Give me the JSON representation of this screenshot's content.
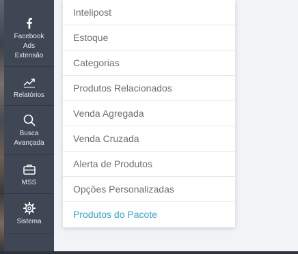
{
  "sidebar": {
    "items": [
      {
        "label": "Facebook\nAds\nExtensão",
        "icon": "facebook-icon"
      },
      {
        "label": "Relatórios",
        "icon": "trend-chart-icon"
      },
      {
        "label": "Busca\nAvançada",
        "icon": "search-icon"
      },
      {
        "label": "MSS",
        "icon": "briefcase-icon"
      },
      {
        "label": "Sistema",
        "icon": "gear-icon"
      }
    ]
  },
  "submenu": {
    "items": [
      "Intelipost",
      "Estoque",
      "Categorias",
      "Produtos Relacionados",
      "Venda Agregada",
      "Venda Cruzada",
      "Alerta de Produtos",
      "Opções Personalizadas",
      "Produtos do Pacote"
    ],
    "active": "Produtos do Pacote"
  },
  "colors": {
    "sidebar_bg": "#3f4654",
    "panel_bg": "#ffffff",
    "page_bg": "#f1f3f7",
    "item_text": "#6b6f75",
    "active_text": "#3aa2cf"
  }
}
